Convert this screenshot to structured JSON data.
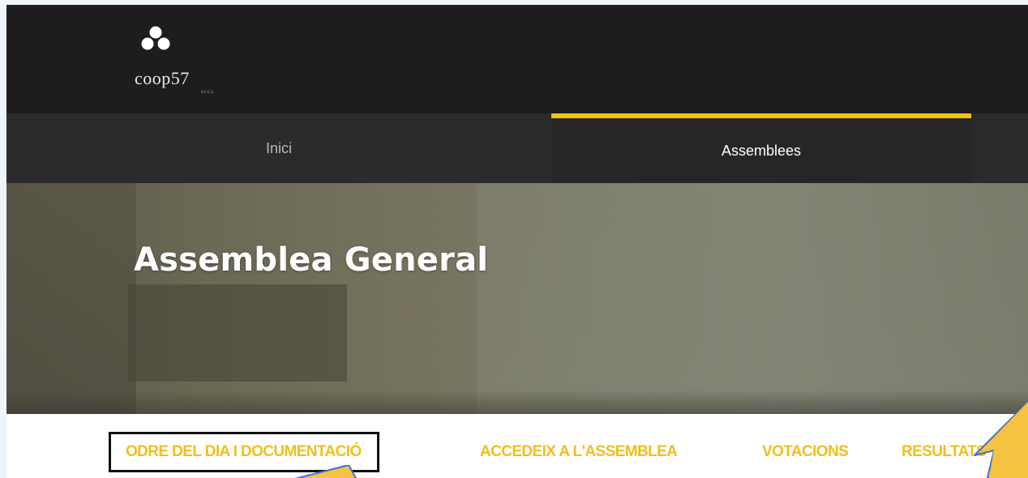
{
  "header": {
    "logo_text": "coop57",
    "logo_subtext": "SCCL"
  },
  "nav": {
    "items": [
      {
        "label": "Inici",
        "active": false
      },
      {
        "label": "Assemblees",
        "active": true
      }
    ],
    "accent_color": "#f1c40f"
  },
  "hero": {
    "title": "Assemblea General"
  },
  "subnav": {
    "items": [
      {
        "label": "ODRE DEL DIA I DOCUMENTACIÓ",
        "highlighted": true
      },
      {
        "label": "ACCEDEIX A L'ASSEMBLEA",
        "highlighted": false
      },
      {
        "label": "VOTACIONS",
        "highlighted": false
      },
      {
        "label": "RESULTATS",
        "highlighted": false,
        "partially_hidden": true
      }
    ],
    "text_color": "#f2be1b"
  },
  "annotations": {
    "callout_color": "#f5c242",
    "callout_icons": [
      "arrow-callout-icon",
      "arrow-callout-icon"
    ]
  }
}
